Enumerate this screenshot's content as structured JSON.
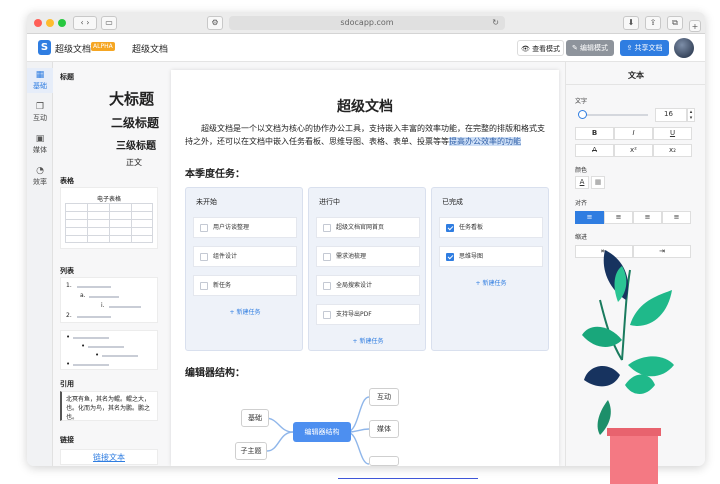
{
  "browser": {
    "url": "sdocapp.com"
  },
  "app": {
    "name": "超级文档",
    "badge": "ALPHA",
    "doc_title": "超级文档",
    "logo": "S",
    "view_mode": "查看模式",
    "edit_mode": "编辑模式",
    "share": "共享文档"
  },
  "sidebar": {
    "items": [
      {
        "label": "基础",
        "icon": "grid-icon"
      },
      {
        "label": "互动",
        "icon": "interaction-icon"
      },
      {
        "label": "媒体",
        "icon": "media-icon"
      },
      {
        "label": "效率",
        "icon": "efficiency-icon"
      }
    ]
  },
  "left_panel": {
    "title_section": "标题",
    "h1": "大标题",
    "h2": "二级标题",
    "h3": "三级标题",
    "body": "正文",
    "table_section": "表格",
    "table_caption": "电子表格",
    "list_section": "列表",
    "list_markers": [
      "1.",
      "a.",
      "i.",
      "2."
    ],
    "quote_section": "引用",
    "quote_text": "北冥有鱼，其名为鲲。鲲之大，也。化而为鸟，其名为鹏。鹏之也。",
    "link_section": "链接",
    "link_text": "链接文本"
  },
  "document": {
    "title": "超级文档",
    "intro": "超级文档是一个以文档为核心的协作办公工具，支持嵌入丰富的效率功能，在完整的排版和格式支持之外，还可以在文档中嵌入任务看板、思维导图、表格、表单、投票等等",
    "intro_highlight": "提高办公效率的功能",
    "kanban_heading": "本季度任务：",
    "columns": [
      {
        "title": "未开始",
        "tasks": [
          {
            "text": "用户访谈整理",
            "done": false
          },
          {
            "text": "组件设计",
            "done": false
          },
          {
            "text": "新任务",
            "done": false
          }
        ],
        "add": "+ 新建任务"
      },
      {
        "title": "进行中",
        "tasks": [
          {
            "text": "超级文档官网首页",
            "done": false
          },
          {
            "text": "需求池梳理",
            "done": false
          },
          {
            "text": "全局搜索设计",
            "done": false
          },
          {
            "text": "支持导出PDF",
            "done": false
          }
        ],
        "add": "+ 新建任务"
      },
      {
        "title": "已完成",
        "tasks": [
          {
            "text": "任务看板",
            "done": true
          },
          {
            "text": "思维导图",
            "done": true
          }
        ],
        "add": "+ 新建任务"
      }
    ],
    "mindmap_heading": "编辑器结构：",
    "mindmap": {
      "center": "编辑器结构",
      "nodes": [
        "基础",
        "子主题",
        "互动",
        "媒体"
      ]
    }
  },
  "right_panel": {
    "title": "文本",
    "text_section": "文字",
    "font_size": "16",
    "format_buttons": [
      "B",
      "I",
      "U",
      "A",
      "x²",
      "x₂"
    ],
    "color_section": "颜色",
    "align_section": "对齐",
    "indent_section": "缩进"
  }
}
